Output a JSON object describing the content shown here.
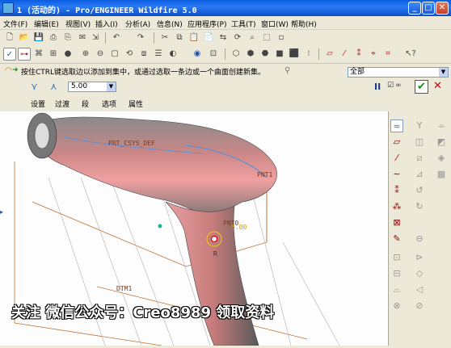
{
  "window": {
    "title": "1 (活动的) - Pro/ENGINEER Wildfire 5.0"
  },
  "menu": [
    "文件(F)",
    "编辑(E)",
    "视图(V)",
    "插入(I)",
    "分析(A)",
    "信息(N)",
    "应用程序(P)",
    "工具(T)",
    "窗口(W)",
    "帮助(H)"
  ],
  "dashboard": {
    "prompt": "按住CTRL键选取边以添加到集中，或通过选取一条边或一个曲面创建新集。",
    "filter_value": "全部",
    "radius_value": "5.00",
    "tabs": [
      "设置",
      "过渡",
      "段",
      "选项",
      "属性"
    ],
    "pause_icon": "pause-icon",
    "preview_icon": "glasses-preview-icon",
    "ok_icon": "checkmark-icon",
    "cancel_icon": "cancel-x-icon"
  },
  "model": {
    "datum_labels": [
      "PRT_CSYS_DEF",
      "PNT1",
      "PNT0",
      "DTM1"
    ],
    "round_value": "5.00",
    "round_label": "R"
  },
  "watermark": "关注 微信公众号：Creo8989 领取资料",
  "colors": {
    "titlebar": "#0a5ddf",
    "model_pink": "#e89a9a",
    "model_grey": "#7d7d7d",
    "datum_orange": "#c07030"
  }
}
